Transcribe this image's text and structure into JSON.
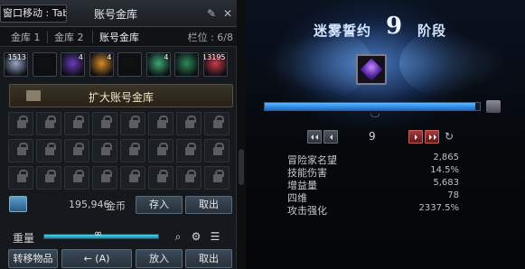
{
  "left_panel": {
    "title_move": "窗口移动 : Tab",
    "title": "账号金库",
    "tabs": [
      "金库 1",
      "金库 2",
      "账号金库"
    ],
    "slots": "栏位 : 6/8",
    "items": [
      {
        "count": "1513",
        "icon": "wing-icon",
        "color": "#9aa8c8"
      },
      {
        "count": "",
        "icon": "empty-slot-icon",
        "color": "#111214"
      },
      {
        "count": "4",
        "icon": "purple-orb-icon",
        "color": "#6a3ab8"
      },
      {
        "count": "4",
        "icon": "flame-icon",
        "color": "#d88a2a"
      },
      {
        "count": "",
        "icon": "empty-slot-icon",
        "color": "#111214"
      },
      {
        "count": "4",
        "icon": "green-swirl-icon",
        "color": "#3aa870"
      },
      {
        "count": "",
        "icon": "green-badge-icon",
        "color": "#2a8a5a"
      },
      {
        "count": "13195",
        "icon": "red-gem-icon",
        "color": "#c83a4a"
      }
    ],
    "expand_label": "扩大账号金库",
    "gold_value": "195,946",
    "gold_unit": "金币",
    "deposit_label": "存入",
    "withdraw_label": "取出",
    "weight_label": "重量",
    "weight_text": "∞",
    "weight_fraction": 1.0,
    "transfer_label": "转移物品",
    "transfer_hint": "← (A)",
    "put_label": "放入",
    "take_label": "取出"
  },
  "right_panel": {
    "title_left": "迷雾誓约",
    "stage_number": "9",
    "title_right": "阶段",
    "progress_fraction": 0.98,
    "page_number": "9",
    "stats": [
      {
        "label": "冒险家名望",
        "value": "2,865"
      },
      {
        "label": "技能伤害",
        "value": "14.5%"
      },
      {
        "label": "增益量",
        "value": "5,683"
      },
      {
        "label": "四维",
        "value": "78"
      },
      {
        "label": "攻击强化",
        "value": "2337.5%"
      }
    ]
  },
  "colors": {
    "accent_blue": "#1a6ad0",
    "page_red": "#a83a3a",
    "weight_cyan": "#4ad4ea"
  }
}
